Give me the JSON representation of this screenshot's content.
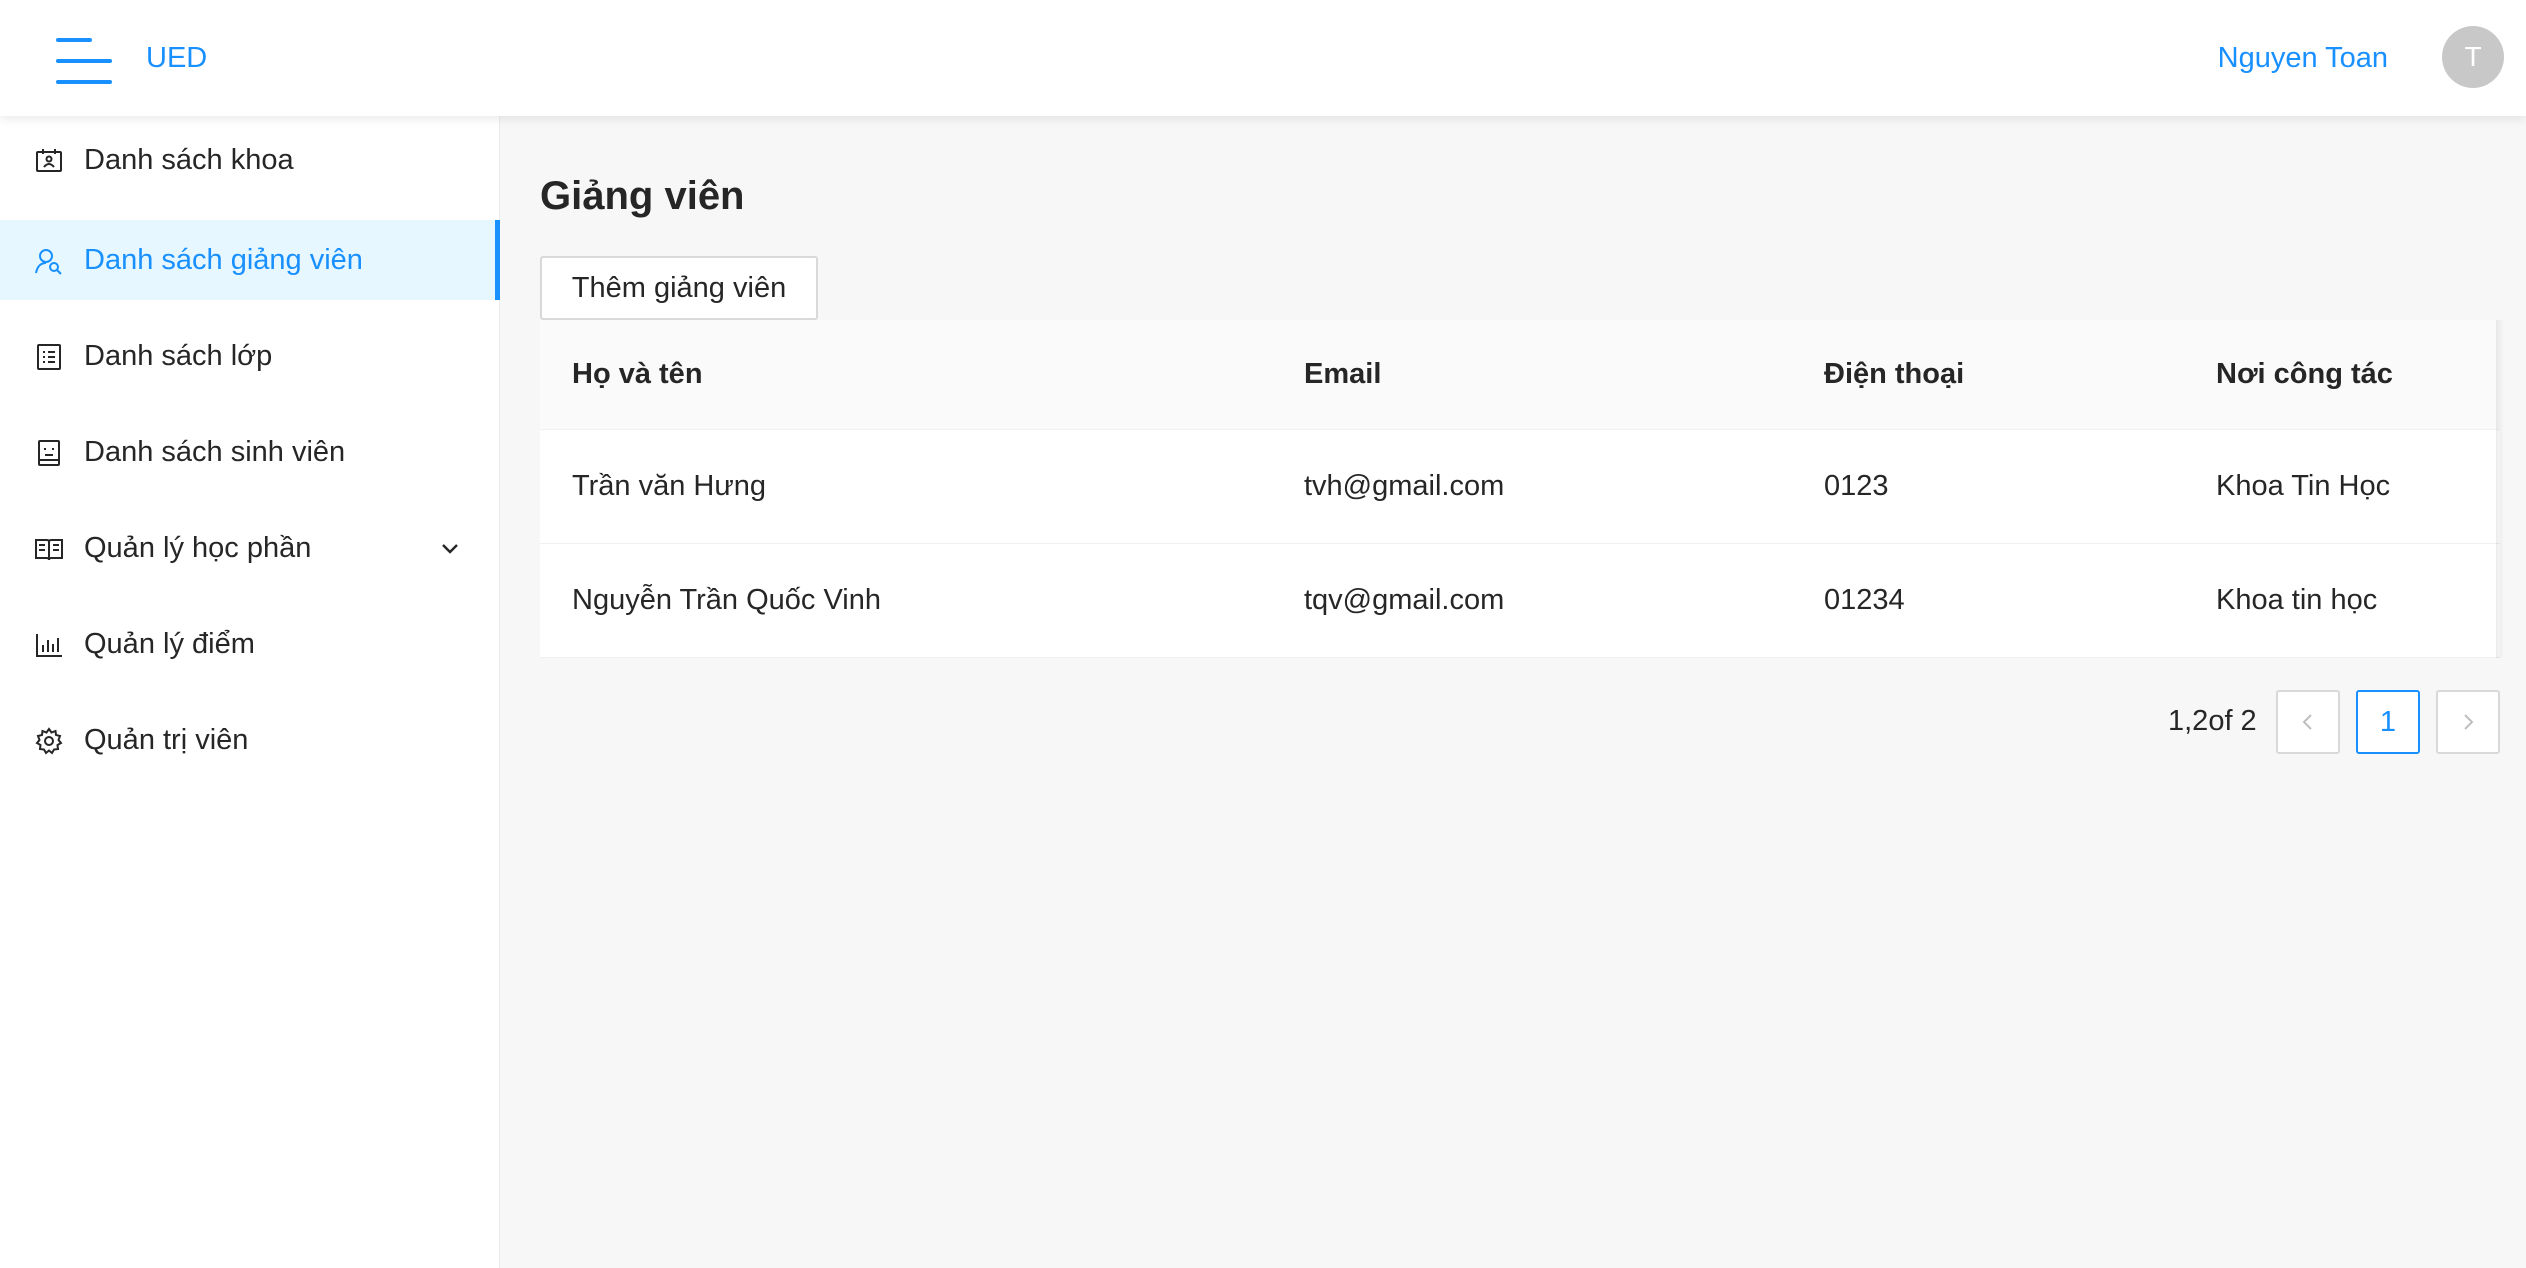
{
  "header": {
    "brand": "UED",
    "user_name": "Nguyen Toan",
    "avatar_initial": "T"
  },
  "sidebar": {
    "items": [
      {
        "label": "Danh sách khoa",
        "icon": "id-card-icon"
      },
      {
        "label": "Danh sách giảng viên",
        "icon": "user-search-icon",
        "active": true
      },
      {
        "label": "Danh sách lớp",
        "icon": "list-document-icon"
      },
      {
        "label": "Danh sách sinh viên",
        "icon": "student-icon"
      },
      {
        "label": "Quản lý học phần",
        "icon": "book-icon",
        "expandable": true
      },
      {
        "label": "Quản lý điểm",
        "icon": "bar-chart-icon"
      },
      {
        "label": "Quản trị viên",
        "icon": "gear-icon"
      }
    ]
  },
  "main": {
    "title": "Giảng viên",
    "add_button": "Thêm giảng viên",
    "table": {
      "headers": [
        "Họ và tên",
        "Email",
        "Điện thoại",
        "Nơi công tác"
      ],
      "rows": [
        [
          "Trần văn Hưng",
          "tvh@gmail.com",
          "0123",
          "Khoa Tin Học"
        ],
        [
          "Nguyễn Trần Quốc Vinh",
          "tqv@gmail.com",
          "01234",
          "Khoa tin học"
        ]
      ]
    },
    "pagination": {
      "total_text": "1,2of 2",
      "current_page": "1"
    }
  },
  "colors": {
    "accent": "#1890ff",
    "active_bg": "#e6f7ff",
    "page_bg": "#f7f7f7"
  }
}
